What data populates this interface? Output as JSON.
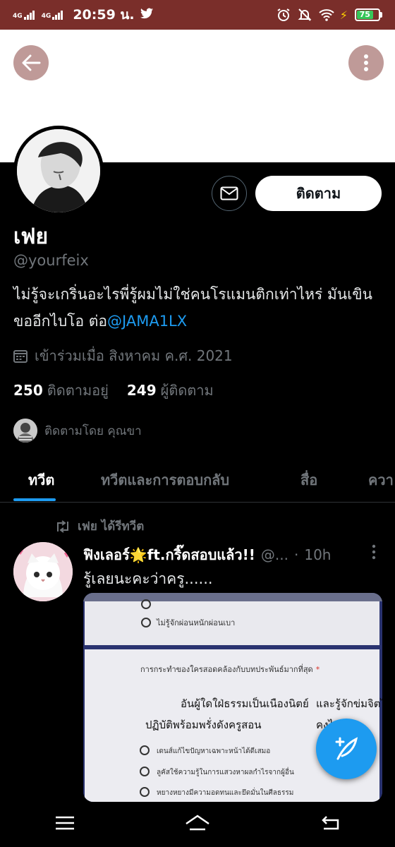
{
  "status_bar": {
    "network_1": "4G",
    "network_2": "4G",
    "time": "20:59 น.",
    "battery": "75",
    "battery_level": 0.75
  },
  "profile": {
    "display_name": "เฟย",
    "handle": "@yourfeix",
    "bio_text": "ไม่รู้จะเกริ่นอะไรพี่รู้ผมไม่ใช่คนโรแมนติกเท่าไหร่ มันเขินขออีกไบโอ ต่อ",
    "bio_mention": "@JAMA1LX",
    "joined": "เข้าร่วมเมื่อ สิงหาคม ค.ศ. 2021",
    "following_count": "250",
    "following_label": "ติดตามอยู่",
    "followers_count": "249",
    "followers_label": "ผู้ติดตาม",
    "followed_by": "ติดตามโดย คุณขา",
    "follow_button": "ติดตาม"
  },
  "tabs": [
    {
      "label": "ทวีต",
      "active": true
    },
    {
      "label": "ทวีตและการตอบกลับ",
      "active": false
    },
    {
      "label": "สื่อ",
      "active": false
    },
    {
      "label": "ควา",
      "active": false
    }
  ],
  "tweet": {
    "retweet_label": "เฟย ได้รีทวีต",
    "author_name": "ฟิงเลอร์🌟ft.กริ๊ดสอบแล้ว!!",
    "author_handle": "@...",
    "separator": "·",
    "time": "10h",
    "text": "รู้เลยนะคะว่าครู......",
    "media": {
      "top_line": "ไม่รู้จักผ่อนหนักผ่อนเบา",
      "question": "การกระทำของใครสอดคล้องกับบทประพันธ์มากที่สุด",
      "required": "*",
      "poem_1": "อันผู้ใดใฝ่ธรรมเป็นเนืองนิตย์",
      "poem_2": "และรู้จักข่มจิตไม่",
      "poem_3": "ปฏิบัติพร้อมพรั่งดังครูสอน",
      "poem_4": "คงไม่ร้อน",
      "options": [
        "เดนส์แก้ไขปัญหาเฉพาะหน้าได้ดีเสมอ",
        "ลูคัสใช้ความรู้ในการแสวงหาผลกำไรจากผู้อื่น",
        "หยางหยางมีความอดทนและยึดมั่นในศีลธรรม"
      ]
    }
  },
  "colors": {
    "accent": "#1d9bf0",
    "status_bar": "#7a2e2a",
    "muted": "#71767b"
  }
}
